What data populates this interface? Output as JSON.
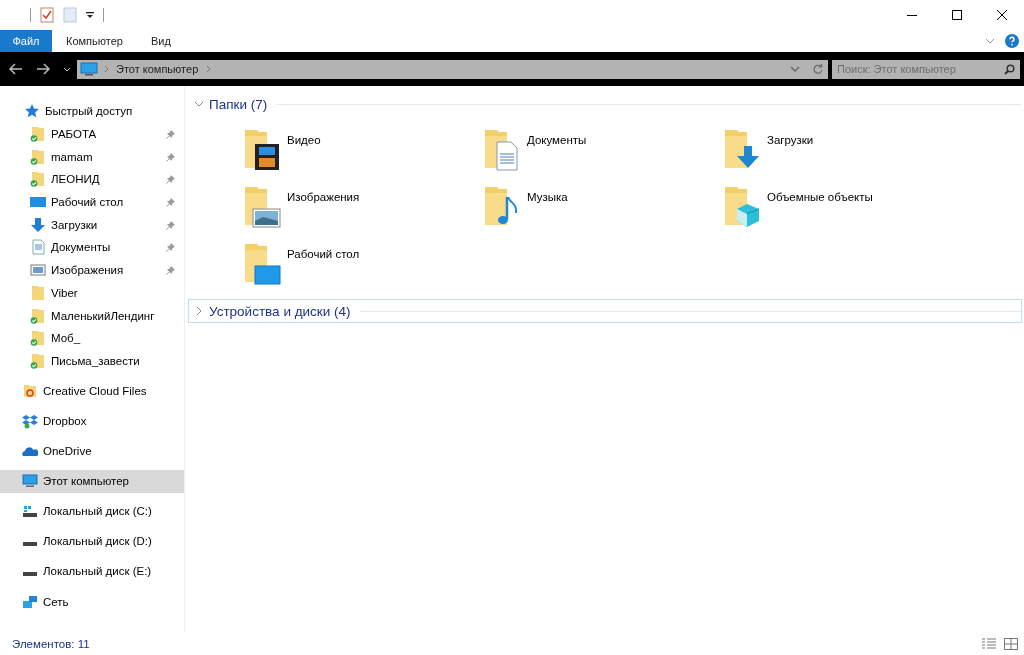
{
  "ribbon": {
    "tabs": [
      {
        "label": "Файл",
        "selected": true
      },
      {
        "label": "Компьютер",
        "selected": false
      },
      {
        "label": "Вид",
        "selected": false
      }
    ]
  },
  "address_bar": {
    "path": [
      "Этот компьютер"
    ],
    "search": {
      "placeholder": "Поиск: Этот компьютер"
    }
  },
  "sidebar": {
    "items": [
      {
        "label": "Быстрый доступ",
        "kind": "star",
        "selected": false,
        "children": [
          {
            "label": "РАБОТА",
            "kind": "folder",
            "synced": true,
            "pinned": true,
            "selected": false
          },
          {
            "label": "mamam",
            "kind": "folder",
            "synced": true,
            "pinned": true,
            "selected": false
          },
          {
            "label": "ЛЕОНИД",
            "kind": "folder",
            "synced": true,
            "pinned": true,
            "selected": false
          },
          {
            "label": "Рабочий стол",
            "kind": "desktop",
            "synced": false,
            "pinned": true,
            "selected": false
          },
          {
            "label": "Загрузки",
            "kind": "download",
            "synced": false,
            "pinned": true,
            "selected": false
          },
          {
            "label": "Документы",
            "kind": "document",
            "synced": false,
            "pinned": true,
            "selected": false
          },
          {
            "label": "Изображения",
            "kind": "picture",
            "synced": false,
            "pinned": true,
            "selected": false
          },
          {
            "label": "Viber",
            "kind": "folder",
            "synced": false,
            "pinned": false,
            "selected": false
          },
          {
            "label": "МаленькийЛендинг",
            "kind": "folder",
            "synced": true,
            "pinned": false,
            "selected": false
          },
          {
            "label": "Моб_",
            "kind": "folder",
            "synced": true,
            "pinned": false,
            "selected": false
          },
          {
            "label": "Письма_завести",
            "kind": "folder",
            "synced": true,
            "pinned": false,
            "selected": false
          }
        ]
      },
      {
        "label": "Creative Cloud Files",
        "kind": "cloud-folder",
        "selected": false
      },
      {
        "label": "Dropbox",
        "kind": "dropbox",
        "selected": false
      },
      {
        "label": "OneDrive",
        "kind": "onedrive",
        "selected": false
      },
      {
        "label": "Этот компьютер",
        "kind": "computer",
        "selected": true
      },
      {
        "label": "Локальный диск (C:)",
        "kind": "system-drive",
        "selected": false
      },
      {
        "label": "Локальный диск (D:)",
        "kind": "drive",
        "selected": false
      },
      {
        "label": "Локальный диск (E:)",
        "kind": "drive",
        "selected": false
      },
      {
        "label": "Сеть",
        "kind": "network",
        "selected": false
      }
    ]
  },
  "sections": [
    {
      "title": "Папки (7)",
      "expanded": true,
      "focused": false,
      "items": [
        {
          "label": "Видео",
          "kind": "video"
        },
        {
          "label": "Документы",
          "kind": "document"
        },
        {
          "label": "Загрузки",
          "kind": "download"
        },
        {
          "label": "Изображения",
          "kind": "picture"
        },
        {
          "label": "Музыка",
          "kind": "music"
        },
        {
          "label": "Объемные объекты",
          "kind": "objects"
        },
        {
          "label": "Рабочий стол",
          "kind": "desktop"
        }
      ]
    },
    {
      "title": "Устройства и диски (4)",
      "expanded": false,
      "focused": true
    }
  ],
  "status_bar": {
    "count": "Элементов: 11"
  }
}
